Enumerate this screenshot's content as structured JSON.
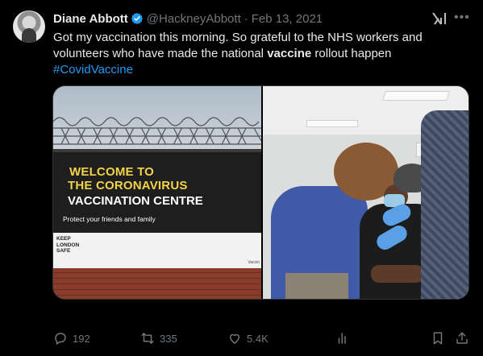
{
  "author": {
    "name": "Diane Abbott",
    "handle": "@HackneyAbbott",
    "separator": "·",
    "date": "Feb 13, 2021"
  },
  "tweet": {
    "text_part1": "Got my vaccination this morning. So grateful to the NHS workers and volunteers who have made the national ",
    "text_bold": "vaccine",
    "text_part2": " rollout happen",
    "hashtag": "#CovidVaccine"
  },
  "media": {
    "left_banner_line1": "WELCOME TO",
    "left_banner_line2": "THE CORONAVIRUS",
    "left_banner_line3": "VACCINATION CENTRE",
    "left_banner_line4": "Protect your friends and family",
    "left_sign_small": "KEEP LONDON SAFE",
    "left_sign_corner": "Vaccin"
  },
  "actions": {
    "replies": "192",
    "retweets": "335",
    "likes": "5.4K"
  },
  "colors": {
    "background": "#000000",
    "text": "#e7e9ea",
    "muted": "#71767b",
    "link": "#1d9bf0",
    "verified": "#1d9bf0"
  },
  "icons": [
    "avatar",
    "verified-badge-icon",
    "grok-icon",
    "more-icon",
    "reply-icon",
    "retweet-icon",
    "like-icon",
    "views-icon",
    "bookmark-icon",
    "share-icon"
  ]
}
